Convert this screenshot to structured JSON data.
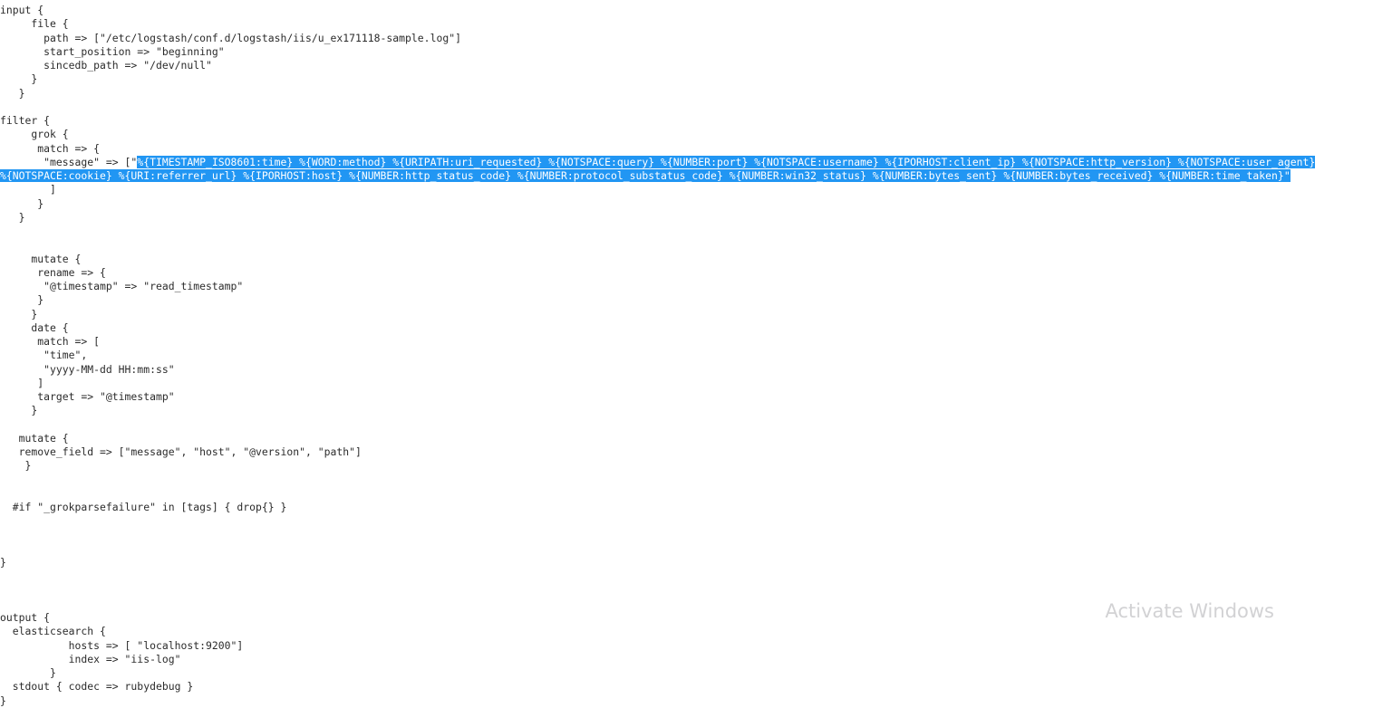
{
  "editor": {
    "language": "logstash-conf",
    "text_color": "#2b2b2b",
    "background_color": "#ffffff",
    "selection_color": "#2196f3",
    "selection_text_color": "#ffffff",
    "lines": [
      "input {",
      "     file {",
      "       path => [\"/etc/logstash/conf.d/logstash/iis/u_ex171118-sample.log\"]",
      "       start_position => \"beginning\"",
      "       sincedb_path => \"/dev/null\"",
      "     }",
      "   }",
      "",
      "filter {",
      "     grok {",
      "      match => {",
      "       \"message\" => [\"",
      "",
      "",
      "        ]",
      "      }",
      "   }",
      "",
      "     mutate {",
      "      rename => {",
      "       \"@timestamp\" => \"read_timestamp\"",
      "      }",
      "     }",
      "     date {",
      "      match => [",
      "       \"time\",",
      "       \"yyyy-MM-dd HH:mm:ss\"",
      "      ]",
      "      target => \"@timestamp\"",
      "     }",
      "",
      "   mutate {",
      "   remove_field => [\"message\", \"host\", \"@version\", \"path\"]",
      "    }",
      "",
      "  #if \"_grokparsefailure\" in [tags] { drop{} }",
      "",
      "}",
      "",
      "output {",
      "  elasticsearch {",
      "           hosts => [ \"localhost:9200\"]",
      "           index => \"iis-log\"",
      "        }",
      "  stdout { codec => rubydebug }",
      "}"
    ],
    "grok_pattern": {
      "prefix": "       \"message\" => [\"",
      "selected_part_1": "%{TIMESTAMP_ISO8601:time} %{WORD:method} %{URIPATH:uri_requested} %{NOTSPACE:query} %{NUMBER:port} %{NOTSPACE:username} %{IPORHOST:client_ip} %{NOTSPACE:http_version} %{NOTSPACE:user_agent}",
      "selected_part_2": "%{NOTSPACE:cookie} %{URI:referrer_url} %{IPORHOST:host} %{NUMBER:http_status_code} %{NUMBER:protocol_substatus_code} %{NUMBER:win32_status} %{NUMBER:bytes_sent} %{NUMBER:bytes_received} %{NUMBER:time_taken}",
      "suffix": "\""
    }
  },
  "watermark": {
    "title": "Activate Windows",
    "subtitle": ""
  }
}
